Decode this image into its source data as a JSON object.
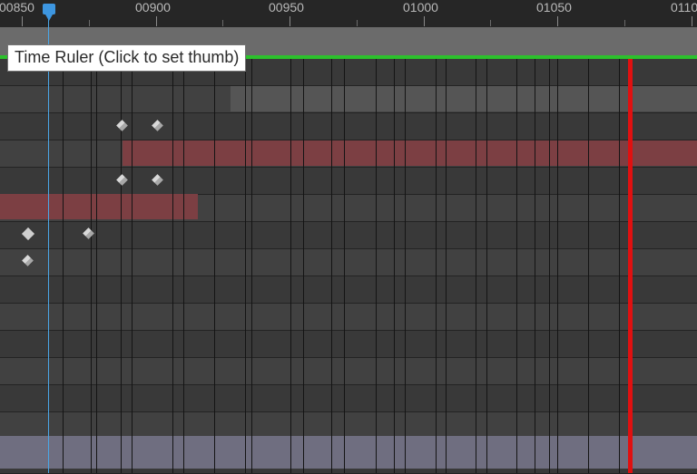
{
  "ruler": {
    "labels": [
      "00850",
      "00900",
      "00950",
      "01000",
      "01050",
      "0110"
    ]
  },
  "tooltip": {
    "text": "Time Ruler (Click to set thumb)"
  },
  "colors": {
    "accent": "#3d96e0",
    "work_area": "#2cc12c",
    "marker": "#e01010",
    "clip_red": "#7c3f43",
    "clip_gray": "#555555"
  },
  "icons": {
    "playhead": "playhead-thumb-icon",
    "keyframe": "keyframe-diamond-icon"
  }
}
